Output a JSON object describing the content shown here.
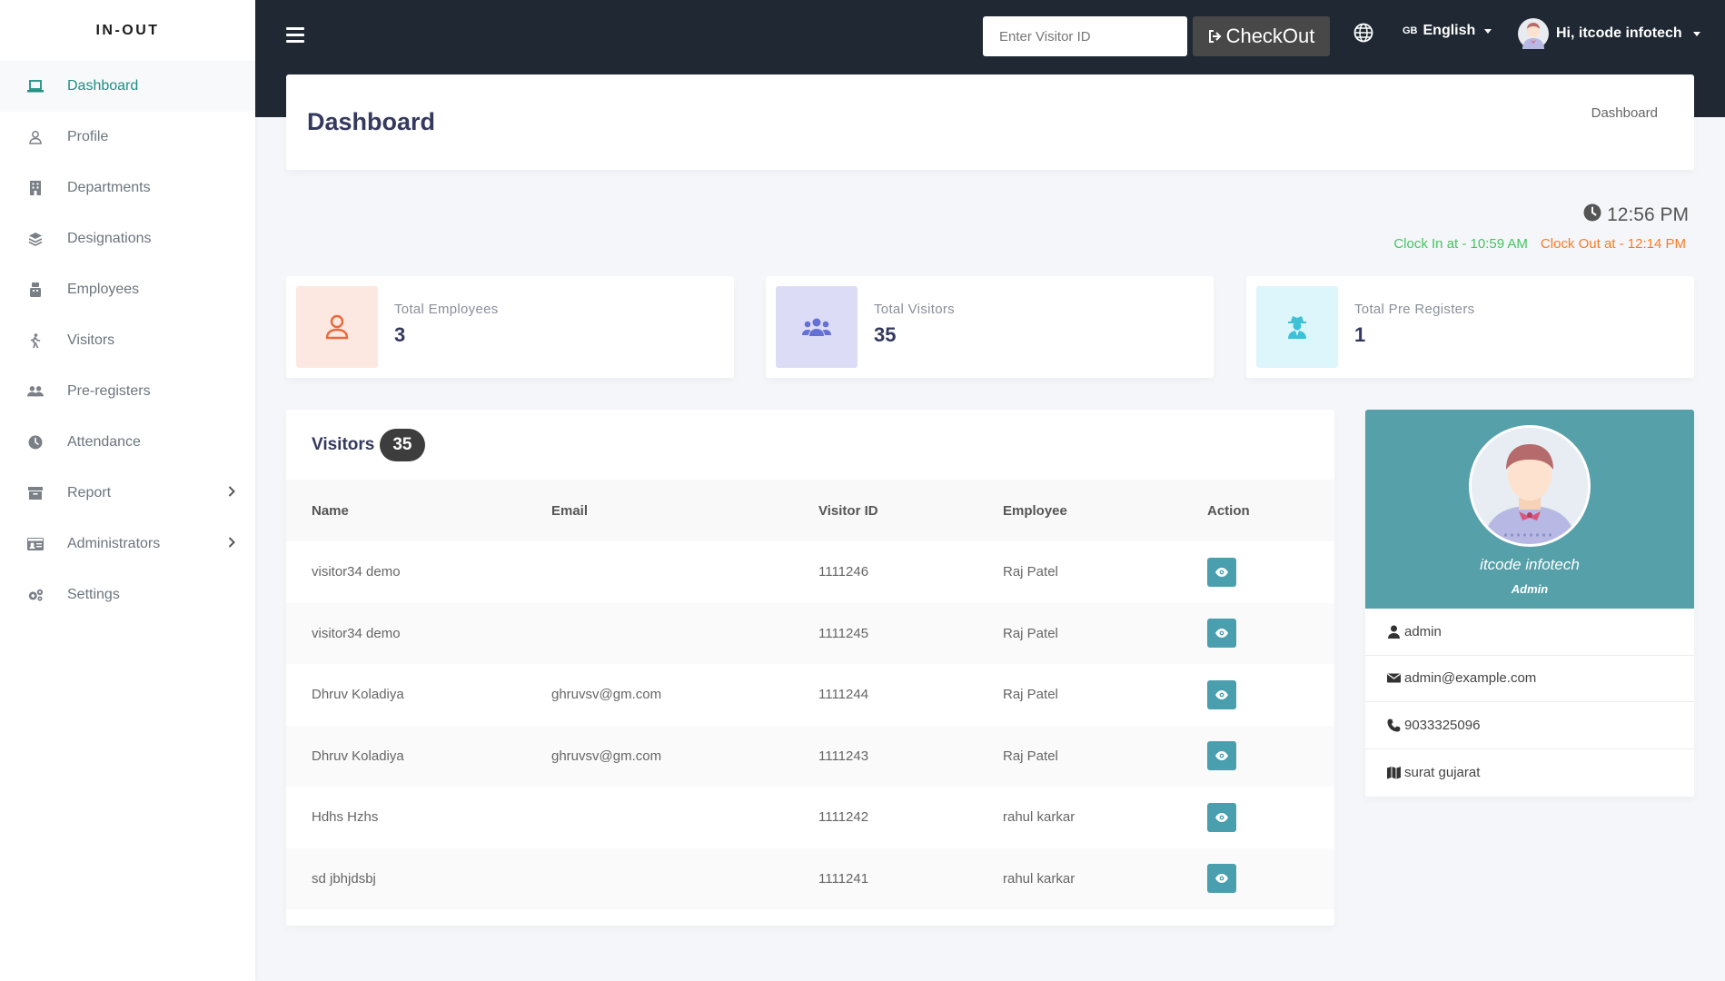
{
  "brand": "IN-OUT",
  "sidebar": {
    "items": [
      {
        "label": "Dashboard"
      },
      {
        "label": "Profile"
      },
      {
        "label": "Departments"
      },
      {
        "label": "Designations"
      },
      {
        "label": "Employees"
      },
      {
        "label": "Visitors"
      },
      {
        "label": "Pre-registers"
      },
      {
        "label": "Attendance"
      },
      {
        "label": "Report"
      },
      {
        "label": "Administrators"
      },
      {
        "label": "Settings"
      }
    ]
  },
  "topbar": {
    "visitor_placeholder": "Enter Visitor ID",
    "checkout_label": "CheckOut",
    "lang_flag": "GB",
    "lang_label": "English",
    "user_greeting": "Hi, itcode infotech"
  },
  "header": {
    "title": "Dashboard",
    "breadcrumb": "Dashboard"
  },
  "clock": {
    "time": "12:56 PM",
    "clock_in": "Clock In at - 10:59 AM",
    "clock_out": "Clock Out at - 12:14 PM"
  },
  "stats": [
    {
      "label": "Total Employees",
      "value": "3"
    },
    {
      "label": "Total Visitors",
      "value": "35"
    },
    {
      "label": "Total Pre Registers",
      "value": "1"
    }
  ],
  "visitors": {
    "title": "Visitors",
    "count": "35",
    "columns": [
      "Name",
      "Email",
      "Visitor ID",
      "Employee",
      "Action"
    ],
    "rows": [
      {
        "name": "visitor34 demo",
        "email": "",
        "visitor_id": "1111246",
        "employee": "Raj Patel"
      },
      {
        "name": "visitor34 demo",
        "email": "",
        "visitor_id": "1111245",
        "employee": "Raj Patel"
      },
      {
        "name": "Dhruv Koladiya",
        "email": "ghruvsv@gm.com",
        "visitor_id": "1111244",
        "employee": "Raj Patel"
      },
      {
        "name": "Dhruv Koladiya",
        "email": "ghruvsv@gm.com",
        "visitor_id": "1111243",
        "employee": "Raj Patel"
      },
      {
        "name": "Hdhs Hzhs",
        "email": "",
        "visitor_id": "1111242",
        "employee": "rahul karkar"
      },
      {
        "name": "sd jbhjdsbj",
        "email": "",
        "visitor_id": "1111241",
        "employee": "rahul karkar"
      }
    ]
  },
  "profile": {
    "name": "itcode infotech",
    "role": "Admin",
    "username": "admin",
    "email": "admin@example.com",
    "phone": "9033325096",
    "address": "surat gujarat"
  },
  "colors": {
    "accent": "#1f8f83",
    "navbar": "#1f2833",
    "profile_header": "#56a0aa",
    "action_button": "#4a9fae",
    "clock_in": "#47c363",
    "clock_out": "#fc7a26"
  }
}
